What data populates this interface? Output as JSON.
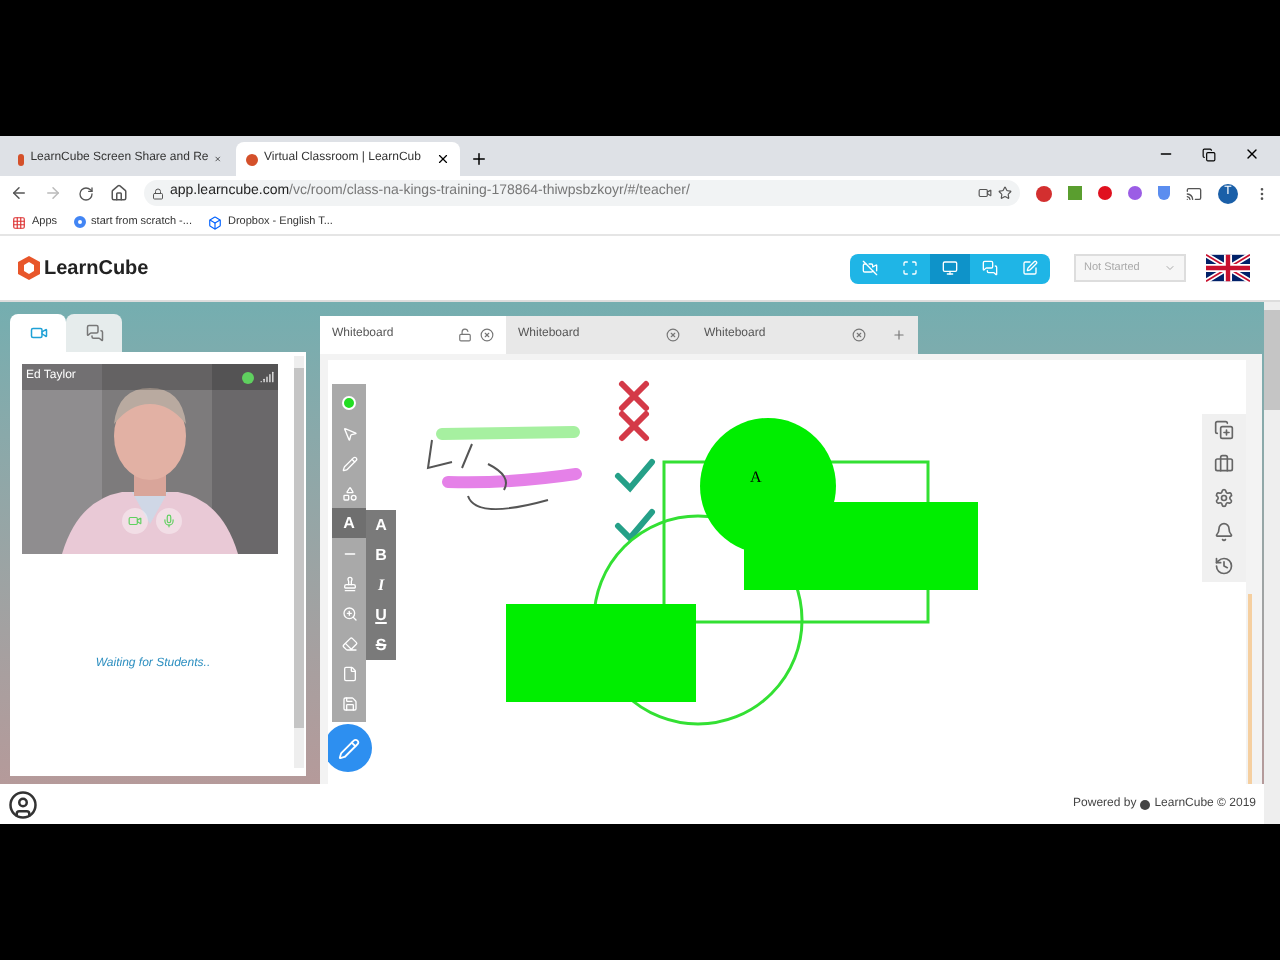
{
  "browser": {
    "tabs": [
      {
        "title": "LearnCube Screen Share and Re",
        "selected": false
      },
      {
        "title": "Virtual Classroom | LearnCub",
        "selected": true
      }
    ],
    "url": {
      "host": "app.learncube.com",
      "path": "/vc/room/class-na-kings-training-178864-thiwpsbzkoyr/#/teacher/"
    },
    "bookmarks": [
      {
        "kind": "apps",
        "label": "Apps"
      },
      {
        "kind": "google",
        "label": "start from scratch -..."
      },
      {
        "kind": "dropbox",
        "label": "Dropbox - English T..."
      }
    ],
    "profile_initial": "T"
  },
  "header": {
    "logo": "LearnCube",
    "view_buttons": [
      {
        "kind": "camera-off",
        "selected": false
      },
      {
        "kind": "fullscreen",
        "selected": false
      },
      {
        "kind": "screen",
        "selected": true
      },
      {
        "kind": "chat",
        "selected": false
      },
      {
        "kind": "edit",
        "selected": false
      }
    ],
    "status": "Not Started"
  },
  "left_panel": {
    "tabs": [
      {
        "kind": "video",
        "selected": true
      },
      {
        "kind": "chat",
        "selected": false
      }
    ],
    "video": {
      "name": "Ed Taylor",
      "kind": "picture"
    },
    "waiting": "Waiting for Students.."
  },
  "whiteboard": {
    "tabs": [
      {
        "label": "Whiteboard",
        "selected": true
      },
      {
        "label": "Whiteboard",
        "selected": false
      },
      {
        "label": "Whiteboard",
        "selected": false
      }
    ],
    "tools": [
      {
        "kind": "color",
        "selected": false
      },
      {
        "kind": "pointer",
        "selected": false
      },
      {
        "kind": "pen",
        "selected": false
      },
      {
        "kind": "shapes",
        "selected": false
      },
      {
        "kind": "text",
        "label": "A",
        "selected": true
      },
      {
        "kind": "line",
        "selected": false
      },
      {
        "kind": "stamp",
        "selected": false
      },
      {
        "kind": "zoom",
        "selected": false
      },
      {
        "kind": "eraser",
        "selected": false
      },
      {
        "kind": "file",
        "selected": false
      },
      {
        "kind": "save",
        "selected": false
      }
    ],
    "text_options": [
      {
        "kind": "plain",
        "label": "A"
      },
      {
        "kind": "bold",
        "label": "B"
      },
      {
        "kind": "italic",
        "label": "I"
      },
      {
        "kind": "underline",
        "label": "U"
      },
      {
        "kind": "strike",
        "label": "S"
      }
    ],
    "canvas_text": "A",
    "side_tools": [
      {
        "kind": "add-page"
      },
      {
        "kind": "toolbox"
      },
      {
        "kind": "settings"
      },
      {
        "kind": "alerts"
      },
      {
        "kind": "history"
      }
    ]
  },
  "footer": {
    "powered": "Powered by",
    "brand": "LearnCube © 2019"
  }
}
